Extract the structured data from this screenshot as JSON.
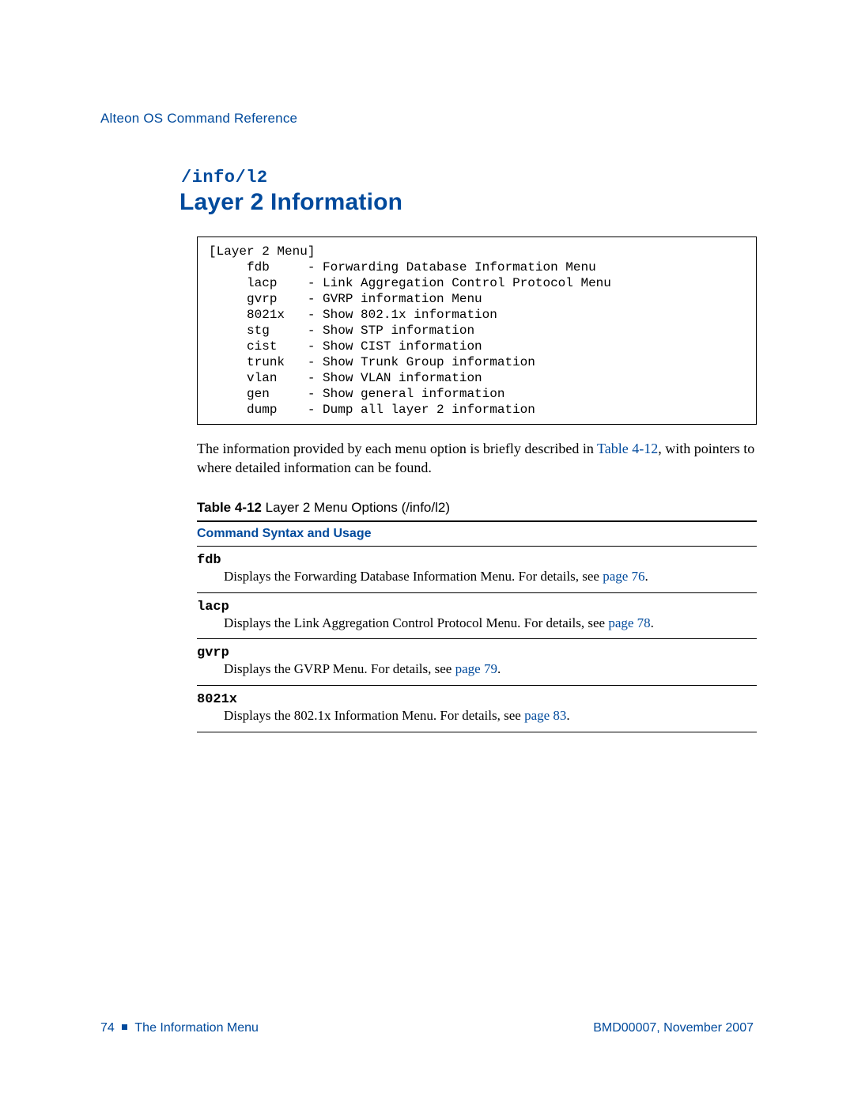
{
  "header": {
    "running_head": "Alteon OS Command Reference"
  },
  "section": {
    "path": "/info/l2",
    "title": "Layer 2 Information"
  },
  "menu": {
    "title": "[Layer 2 Menu]",
    "items": [
      {
        "cmd": "fdb",
        "desc": "Forwarding Database Information Menu"
      },
      {
        "cmd": "lacp",
        "desc": "Link Aggregation Control Protocol Menu"
      },
      {
        "cmd": "gvrp",
        "desc": "GVRP information Menu"
      },
      {
        "cmd": "8021x",
        "desc": "Show 802.1x information"
      },
      {
        "cmd": "stg",
        "desc": "Show STP information"
      },
      {
        "cmd": "cist",
        "desc": "Show CIST information"
      },
      {
        "cmd": "trunk",
        "desc": "Show Trunk Group information"
      },
      {
        "cmd": "vlan",
        "desc": "Show VLAN information"
      },
      {
        "cmd": "gen",
        "desc": "Show general information"
      },
      {
        "cmd": "dump",
        "desc": "Dump all layer 2 information"
      }
    ]
  },
  "paragraph": {
    "pre": "The information provided by each menu option is briefly described in ",
    "ref": "Table 4-12",
    "post": ", with pointers to where detailed information can be found."
  },
  "table": {
    "label": "Table 4-12",
    "caption": "  Layer 2 Menu Options (/info/l2)",
    "header": "Command Syntax and Usage",
    "rows": [
      {
        "cmd": "fdb",
        "desc_pre": "Displays the Forwarding Database Information Menu. For details, see ",
        "page": "page 76",
        "desc_post": "."
      },
      {
        "cmd": "lacp",
        "desc_pre": "Displays the Link Aggregation Control Protocol Menu. For details, see ",
        "page": "page 78",
        "desc_post": "."
      },
      {
        "cmd": "gvrp",
        "desc_pre": "Displays the GVRP Menu. For details, see ",
        "page": "page 79",
        "desc_post": "."
      },
      {
        "cmd": "8021x",
        "desc_pre": "Displays the 802.1x Information Menu. For details, see ",
        "page": "page 83",
        "desc_post": "."
      }
    ]
  },
  "footer": {
    "page_num": "74",
    "section": "The Information Menu",
    "doc_id": "BMD00007, November 2007"
  }
}
